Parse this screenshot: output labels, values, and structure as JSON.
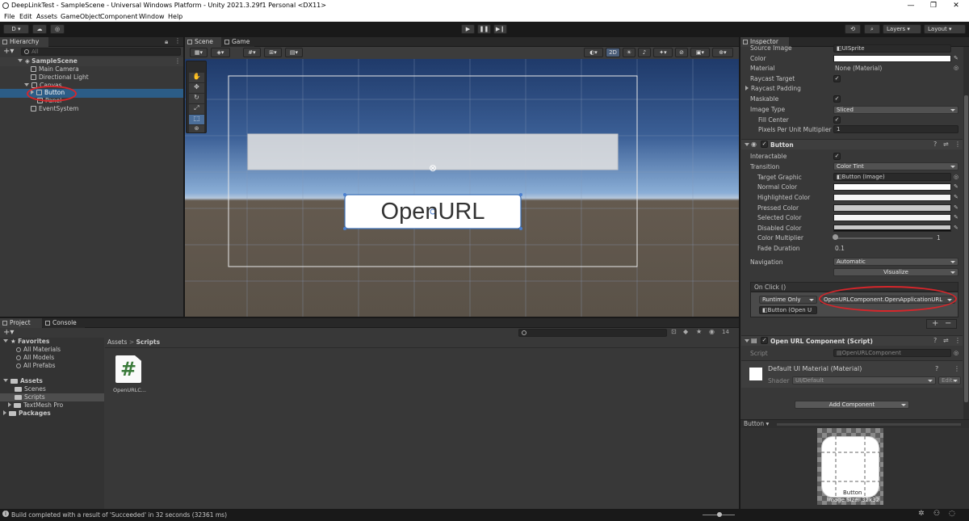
{
  "window": {
    "title": "DeepLinkTest - SampleScene - Universal Windows Platform - Unity 2021.3.29f1 Personal <DX11>",
    "minimize": "—",
    "maximize": "❐",
    "close": "✕"
  },
  "menu": [
    "File",
    "Edit",
    "Assets",
    "GameObject",
    "Component",
    "Window",
    "Help"
  ],
  "toolbar": {
    "account": "D",
    "play": "▶",
    "pause": "❚❚",
    "step": "▶❙",
    "layers": "Layers",
    "layout": "Layout"
  },
  "hierarchy": {
    "tab": "Hierarchy",
    "search_placeholder": "All",
    "scene": "SampleScene",
    "items": [
      "Main Camera",
      "Directional Light",
      "Canvas",
      "Button",
      "Panel",
      "EventSystem"
    ]
  },
  "scene": {
    "tabs": [
      "Scene",
      "Game"
    ],
    "mode_2d": "2D",
    "button_text": "OpenURL"
  },
  "project": {
    "tabs": [
      "Project",
      "Console"
    ],
    "favorites_label": "Favorites",
    "favorites": [
      "All Materials",
      "All Models",
      "All Prefabs"
    ],
    "assets_label": "Assets",
    "assets_children": [
      "Scenes",
      "Scripts",
      "TextMesh Pro"
    ],
    "packages_label": "Packages",
    "breadcrumb": [
      "Assets",
      "Scripts"
    ],
    "count": "14",
    "file_name": "OpenURLC...",
    "file_icon": "#"
  },
  "inspector": {
    "tab": "Inspector",
    "image_props": [
      {
        "label": "Source Image",
        "value": "UISprite"
      },
      {
        "label": "Color",
        "value": ""
      },
      {
        "label": "Material",
        "value": "None (Material)"
      },
      {
        "label": "Raycast Target",
        "value": "✓"
      },
      {
        "label": "Raycast Padding",
        "value": ""
      },
      {
        "label": "Maskable",
        "value": "✓"
      },
      {
        "label": "Image Type",
        "value": "Sliced"
      },
      {
        "label": "Fill Center",
        "value": "✓"
      },
      {
        "label": "Pixels Per Unit Multiplier",
        "value": "1"
      }
    ],
    "button_component": {
      "title": "Button",
      "interactable": "Interactable",
      "transition_label": "Transition",
      "transition_value": "Color Tint",
      "target_graphic_label": "Target Graphic",
      "target_graphic_value": "Button (Image)",
      "colors": [
        "Normal Color",
        "Highlighted Color",
        "Pressed Color",
        "Selected Color",
        "Disabled Color"
      ],
      "color_multiplier_label": "Color Multiplier",
      "color_multiplier_value": "1",
      "fade_label": "Fade Duration",
      "fade_value": "0.1",
      "navigation_label": "Navigation",
      "navigation_value": "Automatic",
      "visualize": "Visualize",
      "onclick_label": "On Click ()",
      "runtime": "Runtime Only",
      "function": "OpenURLComponent.OpenApplicationURL",
      "object": "Button (Open U",
      "plus": "+",
      "minus": "−"
    },
    "script_component": {
      "title": "Open URL Component (Script)",
      "script_label": "Script",
      "script_value": "OpenURLComponent"
    },
    "material": {
      "title": "Default UI Material (Material)",
      "shader_label": "Shader",
      "shader_value": "UI/Default",
      "edit": "Edit..."
    },
    "add_component": "Add Component",
    "preview_label": "Button",
    "preview_name": "Button",
    "preview_size": "Image Size: 32x32"
  },
  "status": {
    "text": "Build completed with a result of 'Succeeded' in 32 seconds (32361 ms)"
  }
}
